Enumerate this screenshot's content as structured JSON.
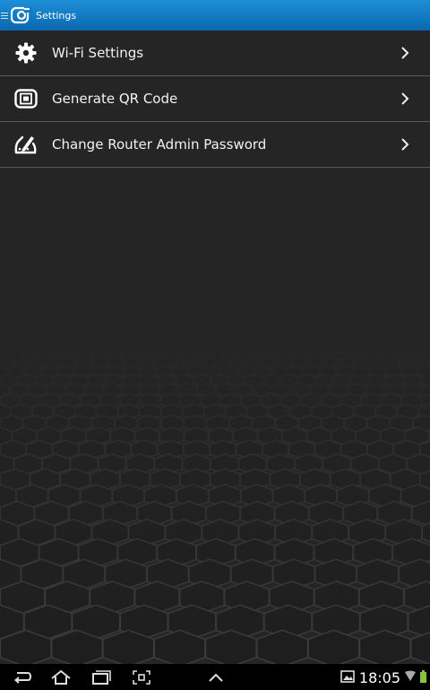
{
  "action_bar": {
    "title": "Settings"
  },
  "settings_list": [
    {
      "label": "Wi-Fi Settings",
      "icon": "gear-icon"
    },
    {
      "label": "Generate QR Code",
      "icon": "qr-code-icon"
    },
    {
      "label": "Change Router Admin Password",
      "icon": "password-edit-icon"
    }
  ],
  "nav_bar": {
    "buttons": [
      "back-icon",
      "home-icon",
      "recent-apps-icon",
      "screenshot-icon",
      "menu-up-icon"
    ],
    "clock": "18:05"
  },
  "colors": {
    "action_bar": "#0f78c2",
    "background": "#252525",
    "divider": "#5a5a5a",
    "battery": "#8ac43f"
  }
}
